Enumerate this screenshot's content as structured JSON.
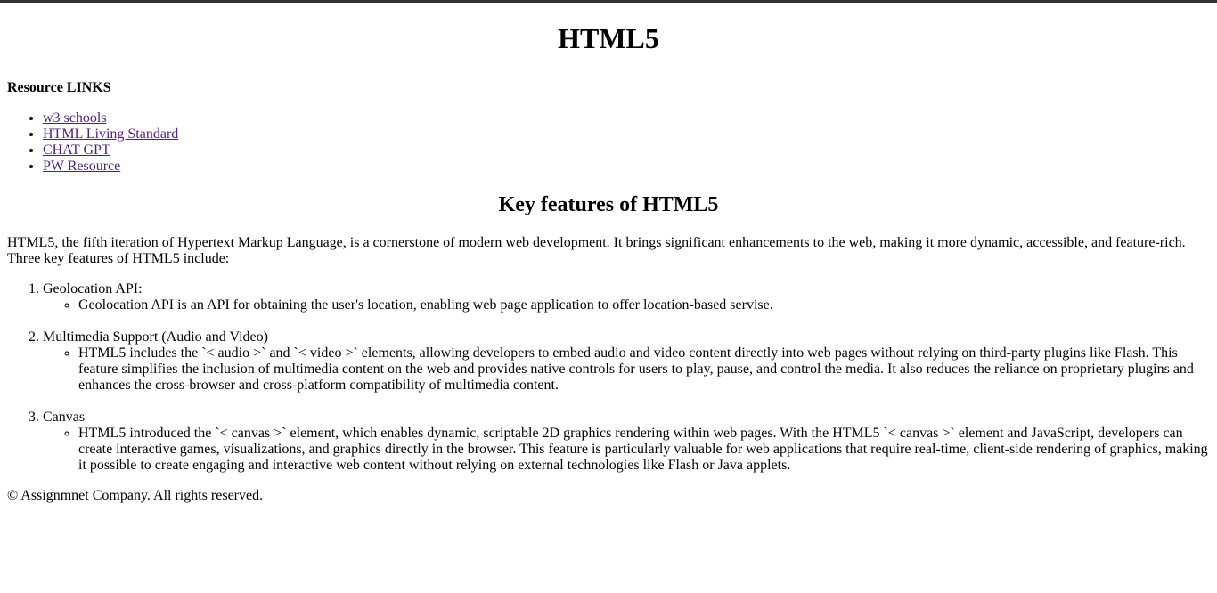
{
  "header": {
    "title": "HTML5"
  },
  "resources": {
    "heading": "Resource LINKS",
    "links": [
      {
        "label": "w3 schools"
      },
      {
        "label": "HTML Living Standard"
      },
      {
        "label": "CHAT GPT"
      },
      {
        "label": "PW Resource"
      }
    ]
  },
  "features": {
    "heading": "Key features of HTML5",
    "intro": "HTML5, the fifth iteration of Hypertext Markup Language, is a cornerstone of modern web development. It brings significant enhancements to the web, making it more dynamic, accessible, and feature-rich. Three key features of HTML5 include:",
    "items": [
      {
        "title": "Geolocation API:",
        "detail": "Geolocation API is an API for obtaining the user's location, enabling web page application to offer location-based servise."
      },
      {
        "title": "Multimedia Support (Audio and Video)",
        "detail": "HTML5 includes the `< audio >` and `< video >` elements, allowing developers to embed audio and video content directly into web pages without relying on third-party plugins like Flash. This feature simplifies the inclusion of multimedia content on the web and provides native controls for users to play, pause, and control the media. It also reduces the reliance on proprietary plugins and enhances the cross-browser and cross-platform compatibility of multimedia content."
      },
      {
        "title": "Canvas",
        "detail": "HTML5 introduced the `< canvas >` element, which enables dynamic, scriptable 2D graphics rendering within web pages. With the HTML5 `< canvas >` element and JavaScript, developers can create interactive games, visualizations, and graphics directly in the browser. This feature is particularly valuable for web applications that require real-time, client-side rendering of graphics, making it possible to create engaging and interactive web content without relying on external technologies like Flash or Java applets."
      }
    ]
  },
  "footer": {
    "text": "© Assignmnet Company. All rights reserved."
  },
  "colors": {
    "topbar": "#333333",
    "visited_link": "#551a8b",
    "text": "#000000",
    "background": "#ffffff"
  }
}
